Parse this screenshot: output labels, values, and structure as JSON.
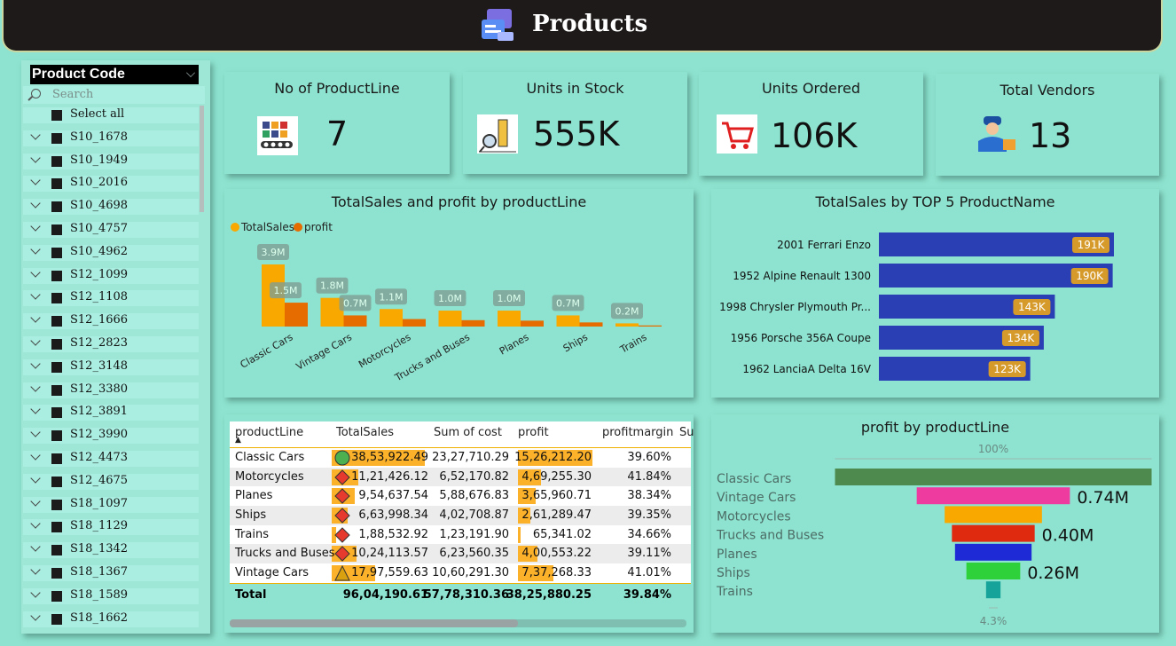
{
  "header": {
    "title": "Products",
    "logo_icon": "product-box-icon"
  },
  "slicer": {
    "title": "Product Code",
    "search_placeholder": "Search",
    "select_all": "Select all",
    "items": [
      "S10_1678",
      "S10_1949",
      "S10_2016",
      "S10_4698",
      "S10_4757",
      "S10_4962",
      "S12_1099",
      "S12_1108",
      "S12_1666",
      "S12_2823",
      "S12_3148",
      "S12_3380",
      "S12_3891",
      "S12_3990",
      "S12_4473",
      "S12_4675",
      "S18_1097",
      "S18_1129",
      "S18_1342",
      "S18_1367",
      "S18_1589",
      "S18_1662"
    ]
  },
  "kpis": [
    {
      "title": "No of ProductLine",
      "value": "7",
      "icon": "toy-products-icon"
    },
    {
      "title": "Units in Stock",
      "value": "555K",
      "icon": "inventory-search-icon"
    },
    {
      "title": "Units Ordered",
      "value": "106K",
      "icon": "shopping-cart-icon"
    },
    {
      "title": "Total Vendors",
      "value": "13",
      "icon": "delivery-worker-icon"
    }
  ],
  "colors": {
    "totalsales": "#f9a800",
    "profit": "#e66c00",
    "hbar": "#2b3fb5",
    "hbar_label": "#d59a2a"
  },
  "chart_data": [
    {
      "type": "bar",
      "title": "TotalSales and profit by productLine",
      "categories": [
        "Classic Cars",
        "Vintage Cars",
        "Motorcycles",
        "Trucks and Buses",
        "Planes",
        "Ships",
        "Trains"
      ],
      "series": [
        {
          "name": "TotalSales",
          "values": [
            3.9,
            1.8,
            1.1,
            1.0,
            1.0,
            0.7,
            0.2
          ]
        },
        {
          "name": "profit",
          "values": [
            1.5,
            0.7,
            0.47,
            0.4,
            0.37,
            0.26,
            0.07
          ]
        }
      ],
      "data_labels": [
        "3.9M",
        "1.5M",
        "1.8M",
        "0.7M",
        "1.1M",
        "1.0M",
        "1.0M",
        "0.7M",
        "0.2M"
      ],
      "legend": "top-left"
    },
    {
      "type": "bar",
      "orientation": "horizontal",
      "title": "TotalSales by TOP 5 ProductName",
      "categories": [
        "2001 Ferrari Enzo",
        "1952 Alpine Renault 1300",
        "1998 Chrysler Plymouth Pr...",
        "1956 Porsche 356A Coupe",
        "1962 LanciaA Delta 16V"
      ],
      "values": [
        191,
        190,
        143,
        134,
        123
      ],
      "labels": [
        "191K",
        "190K",
        "143K",
        "134K",
        "123K"
      ]
    },
    {
      "type": "funnel",
      "title": "profit by productLine",
      "categories": [
        "Classic Cars",
        "Vintage Cars",
        "Motorcycles",
        "Trucks and Buses",
        "Planes",
        "Ships",
        "Trains"
      ],
      "values": [
        1.53,
        0.74,
        0.47,
        0.4,
        0.37,
        0.26,
        0.07
      ],
      "labels": [
        "",
        "0.74M",
        "",
        "0.40M",
        "",
        "0.26M",
        ""
      ],
      "colors": [
        "#4e8a4e",
        "#ee3ba0",
        "#f9a800",
        "#e02a10",
        "#1e2ad6",
        "#2fd13a",
        "#16a39a"
      ],
      "top_label": "100%",
      "bottom_label": "4.3%"
    }
  ],
  "table": {
    "columns": [
      "productLine",
      "TotalSales",
      "Sum of cost",
      "profit",
      "profitmargin",
      "Su"
    ],
    "rows": [
      {
        "line": "Classic Cars",
        "sales": "38,53,922.49",
        "cost": "23,27,710.29",
        "profit": "15,26,212.20",
        "margin": "39.60%",
        "icon": "green-circle-icon",
        "sales_frac": 1.0,
        "profit_frac": 1.0
      },
      {
        "line": "Motorcycles",
        "sales": "11,21,426.12",
        "cost": "6,52,170.82",
        "profit": "4,69,255.30",
        "margin": "41.84%",
        "icon": "red-diamond-icon",
        "sales_frac": 0.29,
        "profit_frac": 0.31
      },
      {
        "line": "Planes",
        "sales": "9,54,637.54",
        "cost": "5,88,676.83",
        "profit": "3,65,960.71",
        "margin": "38.34%",
        "icon": "red-diamond-icon",
        "sales_frac": 0.25,
        "profit_frac": 0.24
      },
      {
        "line": "Ships",
        "sales": "6,63,998.34",
        "cost": "4,02,708.87",
        "profit": "2,61,289.47",
        "margin": "39.35%",
        "icon": "red-diamond-icon",
        "sales_frac": 0.17,
        "profit_frac": 0.17
      },
      {
        "line": "Trains",
        "sales": "1,88,532.92",
        "cost": "1,23,191.90",
        "profit": "65,341.02",
        "margin": "34.66%",
        "icon": "red-diamond-icon",
        "sales_frac": 0.05,
        "profit_frac": 0.04
      },
      {
        "line": "Trucks and Buses",
        "sales": "10,24,113.57",
        "cost": "6,23,560.35",
        "profit": "4,00,553.22",
        "margin": "39.11%",
        "icon": "red-diamond-icon",
        "sales_frac": 0.27,
        "profit_frac": 0.26
      },
      {
        "line": "Vintage Cars",
        "sales": "17,97,559.63",
        "cost": "10,60,291.30",
        "profit": "7,37,268.33",
        "margin": "41.01%",
        "icon": "yellow-triangle-icon",
        "sales_frac": 0.47,
        "profit_frac": 0.48
      }
    ],
    "total": {
      "label": "Total",
      "sales": "96,04,190.61",
      "cost": "57,78,310.36",
      "profit": "38,25,880.25",
      "margin": "39.84%"
    }
  }
}
